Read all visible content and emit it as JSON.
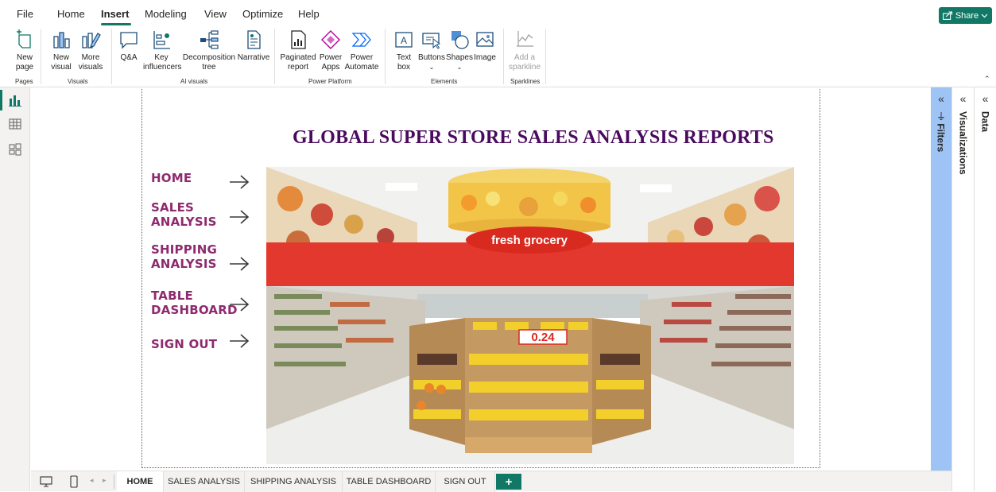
{
  "menu": {
    "items": [
      "File",
      "Home",
      "Insert",
      "Modeling",
      "View",
      "Optimize",
      "Help"
    ],
    "active": "Insert",
    "share_label": "Share"
  },
  "ribbon": {
    "buttons": {
      "new_page": "New page",
      "new_visual": "New visual",
      "more_visuals": "More visuals",
      "qa": "Q&A",
      "key_influencers": "Key influencers",
      "decomposition_tree": "Decomposition tree",
      "narrative": "Narrative",
      "paginated_report": "Paginated report",
      "power_apps": "Power Apps",
      "power_automate": "Power Automate",
      "text_box": "Text box",
      "buttons": "Buttons",
      "shapes": "Shapes",
      "image": "Image",
      "add_sparkline": "Add a sparkline"
    },
    "groups": {
      "pages": "Pages",
      "visuals": "Visuals",
      "ai_visuals": "AI visuals",
      "power_platform": "Power Platform",
      "elements": "Elements",
      "sparklines": "Sparklines"
    }
  },
  "report": {
    "title": "GLOBAL SUPER STORE SALES ANALYSIS REPORTS",
    "nav": [
      {
        "line1": "HOME",
        "line2": ""
      },
      {
        "line1": "SALES",
        "line2": "ANALYSIS"
      },
      {
        "line1": "SHIPPING",
        "line2": "ANALYSIS"
      },
      {
        "line1": "TABLE",
        "line2": "DASHBOARD"
      },
      {
        "line1": "SIGN OUT",
        "line2": ""
      }
    ],
    "hero_sign": "fresh grocery",
    "hero_price": "0.24"
  },
  "panes": {
    "filters": "Filters",
    "visualizations": "Visualizations",
    "data": "Data"
  },
  "tabs": [
    "HOME",
    "SALES ANALYSIS",
    "SHIPPING ANALYSIS",
    "TABLE DASHBOARD",
    "SIGN OUT"
  ],
  "active_tab": "HOME",
  "colors": {
    "accent": "#117865",
    "title": "#4a0a5e",
    "nav_text": "#8e2a6e",
    "filters_pane": "#9ec3f5"
  }
}
